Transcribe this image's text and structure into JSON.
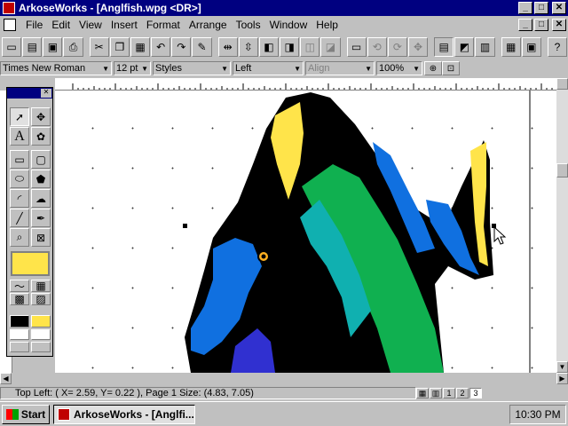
{
  "window": {
    "title": "ArkoseWorks - [Anglfish.wpg <DR>]",
    "minimize": "_",
    "maximize": "□",
    "close": "✕"
  },
  "menu": {
    "items": [
      "File",
      "Edit",
      "View",
      "Insert",
      "Format",
      "Arrange",
      "Tools",
      "Window",
      "Help"
    ]
  },
  "propbar": {
    "font": "Times New Roman",
    "size": "12 pt",
    "styles": "Styles",
    "justify": "Left",
    "align": "Align",
    "zoom": "100%"
  },
  "toolbox": {
    "close": "✕"
  },
  "status": {
    "text": "Top Left: ( X= 2.59, Y= 0.22 ), Page 1  Size: (4.83, 7.05)",
    "pages": [
      "1",
      "2",
      "3"
    ]
  },
  "taskbar": {
    "start": "Start",
    "task": "ArkoseWorks - [Anglfi...",
    "clock": "10:30 PM"
  },
  "colors": {
    "titlebar": "#000080",
    "fill_swatch": "#ffe44a",
    "fish_yellow": "#ffe44a",
    "fish_green": "#10b050",
    "fish_teal": "#10b0b0",
    "fish_blue": "#1070e0"
  }
}
